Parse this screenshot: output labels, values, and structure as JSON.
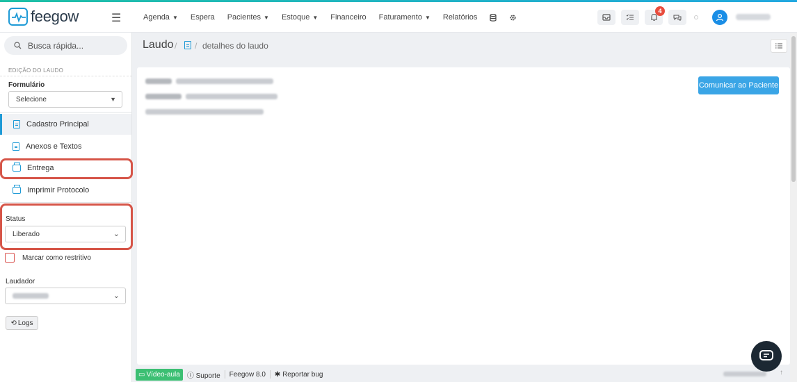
{
  "app": {
    "logo_text": "feegow",
    "accent": "#1e9ad6"
  },
  "nav": {
    "items": [
      {
        "label": "Agenda",
        "dropdown": true
      },
      {
        "label": "Espera",
        "dropdown": false
      },
      {
        "label": "Pacientes",
        "dropdown": true
      },
      {
        "label": "Estoque",
        "dropdown": true
      },
      {
        "label": "Financeiro",
        "dropdown": false
      },
      {
        "label": "Faturamento",
        "dropdown": true
      },
      {
        "label": "Relatórios",
        "dropdown": false
      }
    ],
    "notification_count": "4"
  },
  "sidebar": {
    "search_placeholder": "Busca rápida...",
    "section_title": "EDIÇÃO DO LAUDO",
    "form_label": "Formulário",
    "form_select": "Selecione",
    "menu": [
      {
        "label": "Cadastro Principal",
        "icon": "document-icon",
        "active": true
      },
      {
        "label": "Anexos e Textos",
        "icon": "document-icon",
        "active": false
      },
      {
        "label": "Entrega",
        "icon": "printer-icon",
        "active": false
      },
      {
        "label": "Imprimir Protocolo",
        "icon": "printer-icon",
        "active": false
      }
    ],
    "status_label": "Status",
    "status_value": "Liberado",
    "restrict_label": "Marcar como restritivo",
    "laudador_label": "Laudador",
    "logs_label": "Logs"
  },
  "breadcrumb": {
    "title": "Laudo",
    "detail": "detalhes do laudo"
  },
  "main": {
    "cta_label": "Comunicar ao Paciente"
  },
  "footer": {
    "video_label": "Vídeo-aula",
    "support_label": "Suporte",
    "version_label": "Feegow 8.0",
    "bug_label": "Reportar bug"
  },
  "annotation_color": "#d65548"
}
